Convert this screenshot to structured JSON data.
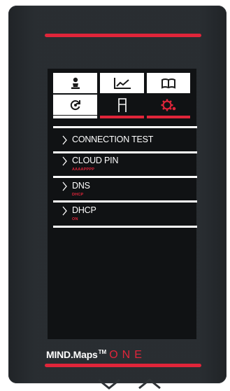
{
  "tabs_row1": [
    {
      "icon": "person-icon"
    },
    {
      "icon": "line-chart-icon"
    },
    {
      "icon": "open-book-icon"
    }
  ],
  "tabs_row2": [
    {
      "icon": "refresh-icon"
    },
    {
      "icon": "door-icon"
    },
    {
      "icon": "settings-gear-icon",
      "active": true
    }
  ],
  "menu": [
    {
      "label": "CONNECTION TEST",
      "value": ""
    },
    {
      "label": "CLOUD PIN",
      "value": "AAAAPPPP"
    },
    {
      "label": "DNS",
      "value": "DHCP"
    },
    {
      "label": "DHCP",
      "value": "ON"
    }
  ],
  "nav": {
    "down_icon": "chevron-down-icon",
    "up_icon": "chevron-up-icon"
  },
  "brand": {
    "name": "MIND.Maps",
    "tm": "TM",
    "suffix": "ONE"
  },
  "colors": {
    "accent": "#e0253a",
    "screen": "#101214",
    "bezel": "#262a2e",
    "text": "#ffffff"
  }
}
